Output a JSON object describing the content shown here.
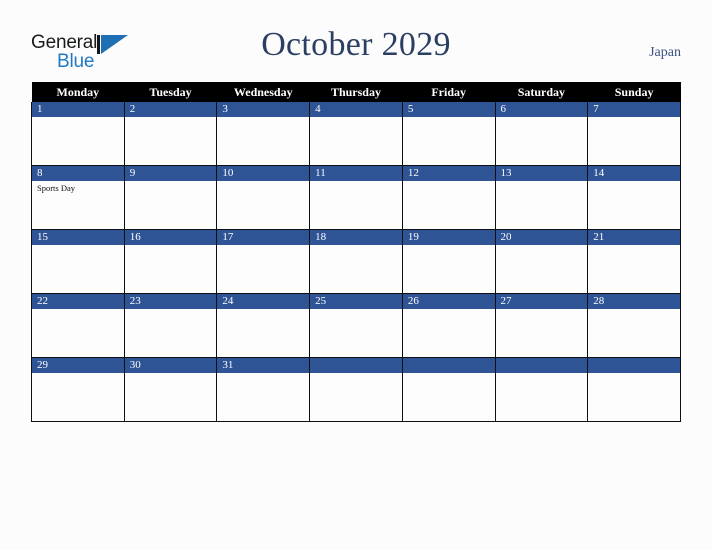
{
  "brand": {
    "name_part1": "General",
    "name_part2": "Blue",
    "triangle_color": "#1f6fb4",
    "bar_color": "#12161c"
  },
  "header": {
    "title": "October 2029",
    "country": "Japan",
    "title_color": "#2b3f63",
    "country_color": "#3c5280"
  },
  "calendar": {
    "weekday_headers": [
      "Monday",
      "Tuesday",
      "Wednesday",
      "Thursday",
      "Friday",
      "Saturday",
      "Sunday"
    ],
    "header_bg": "#000000",
    "header_fg": "#ffffff",
    "day_band_bg": "#2e5496",
    "day_band_fg": "#ffffff",
    "cell_bg": "#fdfdfe",
    "border_color": "#101010",
    "weeks": [
      [
        {
          "date": "1",
          "event": ""
        },
        {
          "date": "2",
          "event": ""
        },
        {
          "date": "3",
          "event": ""
        },
        {
          "date": "4",
          "event": ""
        },
        {
          "date": "5",
          "event": ""
        },
        {
          "date": "6",
          "event": ""
        },
        {
          "date": "7",
          "event": ""
        }
      ],
      [
        {
          "date": "8",
          "event": "Sports Day"
        },
        {
          "date": "9",
          "event": ""
        },
        {
          "date": "10",
          "event": ""
        },
        {
          "date": "11",
          "event": ""
        },
        {
          "date": "12",
          "event": ""
        },
        {
          "date": "13",
          "event": ""
        },
        {
          "date": "14",
          "event": ""
        }
      ],
      [
        {
          "date": "15",
          "event": ""
        },
        {
          "date": "16",
          "event": ""
        },
        {
          "date": "17",
          "event": ""
        },
        {
          "date": "18",
          "event": ""
        },
        {
          "date": "19",
          "event": ""
        },
        {
          "date": "20",
          "event": ""
        },
        {
          "date": "21",
          "event": ""
        }
      ],
      [
        {
          "date": "22",
          "event": ""
        },
        {
          "date": "23",
          "event": ""
        },
        {
          "date": "24",
          "event": ""
        },
        {
          "date": "25",
          "event": ""
        },
        {
          "date": "26",
          "event": ""
        },
        {
          "date": "27",
          "event": ""
        },
        {
          "date": "28",
          "event": ""
        }
      ],
      [
        {
          "date": "29",
          "event": ""
        },
        {
          "date": "30",
          "event": ""
        },
        {
          "date": "31",
          "event": ""
        },
        {
          "date": "",
          "event": ""
        },
        {
          "date": "",
          "event": ""
        },
        {
          "date": "",
          "event": ""
        },
        {
          "date": "",
          "event": ""
        }
      ]
    ]
  }
}
